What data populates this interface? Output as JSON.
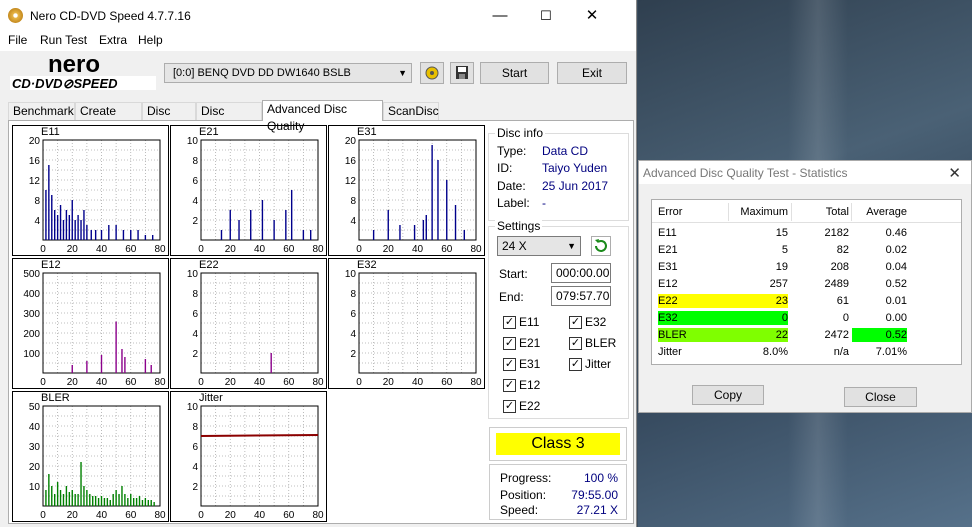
{
  "window": {
    "title": "Nero CD-DVD Speed 4.7.7.16",
    "minimize": "—",
    "maximize": "☐",
    "close": "✕"
  },
  "menu": [
    "File",
    "Run Test",
    "Extra",
    "Help"
  ],
  "toolbar": {
    "drive": "[0:0]   BENQ DVD DD DW1640 BSLB",
    "start": "Start",
    "exit": "Exit"
  },
  "tabs": [
    "Benchmark",
    "Create Disc",
    "Disc Info",
    "Disc Quality",
    "Advanced Disc Quality",
    "ScanDisc"
  ],
  "active_tab": "Advanced Disc Quality",
  "disc_info": {
    "group": "Disc info",
    "type_label": "Type:",
    "type": "Data CD",
    "id_label": "ID:",
    "id": "Taiyo Yuden",
    "date_label": "Date:",
    "date": "25 Jun 2017",
    "label_label": "Label:",
    "label": "-"
  },
  "settings": {
    "group": "Settings",
    "speed": "24 X",
    "start_label": "Start:",
    "start": "000:00.00",
    "end_label": "End:",
    "end": "079:57.70",
    "checkboxes": [
      {
        "label": "E11",
        "checked": true
      },
      {
        "label": "E32",
        "checked": true
      },
      {
        "label": "E21",
        "checked": true
      },
      {
        "label": "BLER",
        "checked": true
      },
      {
        "label": "E31",
        "checked": true
      },
      {
        "label": "Jitter",
        "checked": true
      },
      {
        "label": "E12",
        "checked": true
      },
      {
        "label": "E22",
        "checked": true
      }
    ]
  },
  "class_label": "Class 3",
  "progress": {
    "progress_label": "Progress:",
    "progress": "100 %",
    "position_label": "Position:",
    "position": "79:55.00",
    "speed_label": "Speed:",
    "speed": "27.21 X"
  },
  "charts": [
    {
      "name": "E11",
      "ymax": 20,
      "yticks": [
        "20",
        "16",
        "12",
        "8",
        "4"
      ],
      "color": "#00008b"
    },
    {
      "name": "E21",
      "ymax": 10,
      "yticks": [
        "10",
        "8",
        "6",
        "4",
        "2"
      ],
      "color": "#00008b"
    },
    {
      "name": "E31",
      "ymax": 20,
      "yticks": [
        "20",
        "16",
        "12",
        "8",
        "4"
      ],
      "color": "#00008b"
    },
    {
      "name": "E12",
      "ymax": 500,
      "yticks": [
        "500",
        "400",
        "300",
        "200",
        "100"
      ],
      "color": "#8b008b"
    },
    {
      "name": "E22",
      "ymax": 10,
      "yticks": [
        "10",
        "8",
        "6",
        "4",
        "2"
      ],
      "color": "#8b008b"
    },
    {
      "name": "E32",
      "ymax": 10,
      "yticks": [
        "10",
        "8",
        "6",
        "4",
        "2"
      ],
      "color": "#8b008b"
    },
    {
      "name": "BLER",
      "ymax": 50,
      "yticks": [
        "50",
        "40",
        "30",
        "20",
        "10"
      ],
      "color": "#008000"
    },
    {
      "name": "Jitter",
      "ymax": 10,
      "yticks": [
        "10",
        "8",
        "6",
        "4",
        "2"
      ],
      "color": "#8b0000"
    }
  ],
  "xticks": [
    "0",
    "20",
    "40",
    "60",
    "80"
  ],
  "chart_data": [
    {
      "type": "bar",
      "title": "E11",
      "x": [
        2,
        4,
        6,
        8,
        10,
        12,
        14,
        16,
        18,
        20,
        22,
        24,
        26,
        28,
        30,
        33,
        36,
        40,
        45,
        50,
        55,
        60,
        65,
        70,
        75
      ],
      "values": [
        10,
        15,
        9,
        6,
        5,
        7,
        4,
        6,
        5,
        8,
        4,
        5,
        4,
        6,
        3,
        2,
        2,
        2,
        3,
        3,
        2,
        2,
        2,
        1,
        1
      ],
      "xlim": [
        0,
        80
      ],
      "ylim": [
        0,
        20
      ]
    },
    {
      "type": "bar",
      "title": "E21",
      "x": [
        14,
        20,
        26,
        34,
        42,
        50,
        58,
        62,
        70,
        75
      ],
      "values": [
        1,
        3,
        2,
        3,
        4,
        2,
        3,
        5,
        1,
        1
      ],
      "xlim": [
        0,
        80
      ],
      "ylim": [
        0,
        10
      ]
    },
    {
      "type": "bar",
      "title": "E31",
      "x": [
        10,
        20,
        28,
        38,
        44,
        46,
        50,
        54,
        60,
        66,
        72
      ],
      "values": [
        2,
        6,
        3,
        3,
        4,
        5,
        19,
        16,
        12,
        7,
        2
      ],
      "xlim": [
        0,
        80
      ],
      "ylim": [
        0,
        20
      ]
    },
    {
      "type": "bar",
      "title": "E12",
      "x": [
        20,
        30,
        40,
        50,
        54,
        56,
        70,
        74
      ],
      "values": [
        40,
        60,
        90,
        257,
        120,
        80,
        70,
        40
      ],
      "xlim": [
        0,
        80
      ],
      "ylim": [
        0,
        500
      ]
    },
    {
      "type": "bar",
      "title": "E22",
      "x": [
        48
      ],
      "values": [
        2
      ],
      "xlim": [
        0,
        80
      ],
      "ylim": [
        0,
        10
      ]
    },
    {
      "type": "bar",
      "title": "E32",
      "x": [],
      "values": [],
      "xlim": [
        0,
        80
      ],
      "ylim": [
        0,
        10
      ]
    },
    {
      "type": "bar",
      "title": "BLER",
      "x": [
        2,
        4,
        6,
        8,
        10,
        12,
        14,
        16,
        18,
        20,
        22,
        24,
        26,
        28,
        30,
        32,
        34,
        36,
        38,
        40,
        42,
        44,
        46,
        48,
        50,
        52,
        54,
        56,
        58,
        60,
        62,
        64,
        66,
        68,
        70,
        72,
        74,
        76
      ],
      "values": [
        8,
        16,
        10,
        6,
        12,
        8,
        6,
        10,
        7,
        8,
        6,
        6,
        22,
        10,
        8,
        6,
        5,
        5,
        4,
        5,
        4,
        4,
        3,
        6,
        8,
        6,
        10,
        6,
        4,
        6,
        4,
        4,
        5,
        3,
        4,
        3,
        3,
        2
      ],
      "xlim": [
        0,
        80
      ],
      "ylim": [
        0,
        50
      ]
    },
    {
      "type": "line",
      "title": "Jitter",
      "x": [
        0,
        80
      ],
      "values": [
        7.0,
        7.1
      ],
      "xlim": [
        0,
        80
      ],
      "ylim": [
        0,
        10
      ]
    }
  ],
  "statistics": {
    "title": "Advanced Disc Quality Test - Statistics",
    "columns": [
      "Error",
      "Maximum",
      "Total",
      "Average"
    ],
    "rows": [
      {
        "error": "E11",
        "max": "15",
        "total": "2182",
        "avg": "0.46",
        "maxbg": "",
        "avgbg": ""
      },
      {
        "error": "E21",
        "max": "5",
        "total": "82",
        "avg": "0.02",
        "maxbg": "",
        "avgbg": ""
      },
      {
        "error": "E31",
        "max": "19",
        "total": "208",
        "avg": "0.04",
        "maxbg": "",
        "avgbg": ""
      },
      {
        "error": "E12",
        "max": "257",
        "total": "2489",
        "avg": "0.52",
        "maxbg": "",
        "avgbg": ""
      },
      {
        "error": "E22",
        "max": "23",
        "total": "61",
        "avg": "0.01",
        "maxbg": "#ffff00",
        "avgbg": ""
      },
      {
        "error": "E32",
        "max": "0",
        "total": "0",
        "avg": "0.00",
        "maxbg": "#00ff00",
        "avgbg": ""
      },
      {
        "error": "BLER",
        "max": "22",
        "total": "2472",
        "avg": "0.52",
        "maxbg": "#7fff00",
        "avgbg": "#00ff00"
      },
      {
        "error": "Jitter",
        "max": "8.0%",
        "total": "n/a",
        "avg": "7.01%",
        "maxbg": "",
        "avgbg": ""
      }
    ],
    "copy": "Copy",
    "close": "Close"
  }
}
